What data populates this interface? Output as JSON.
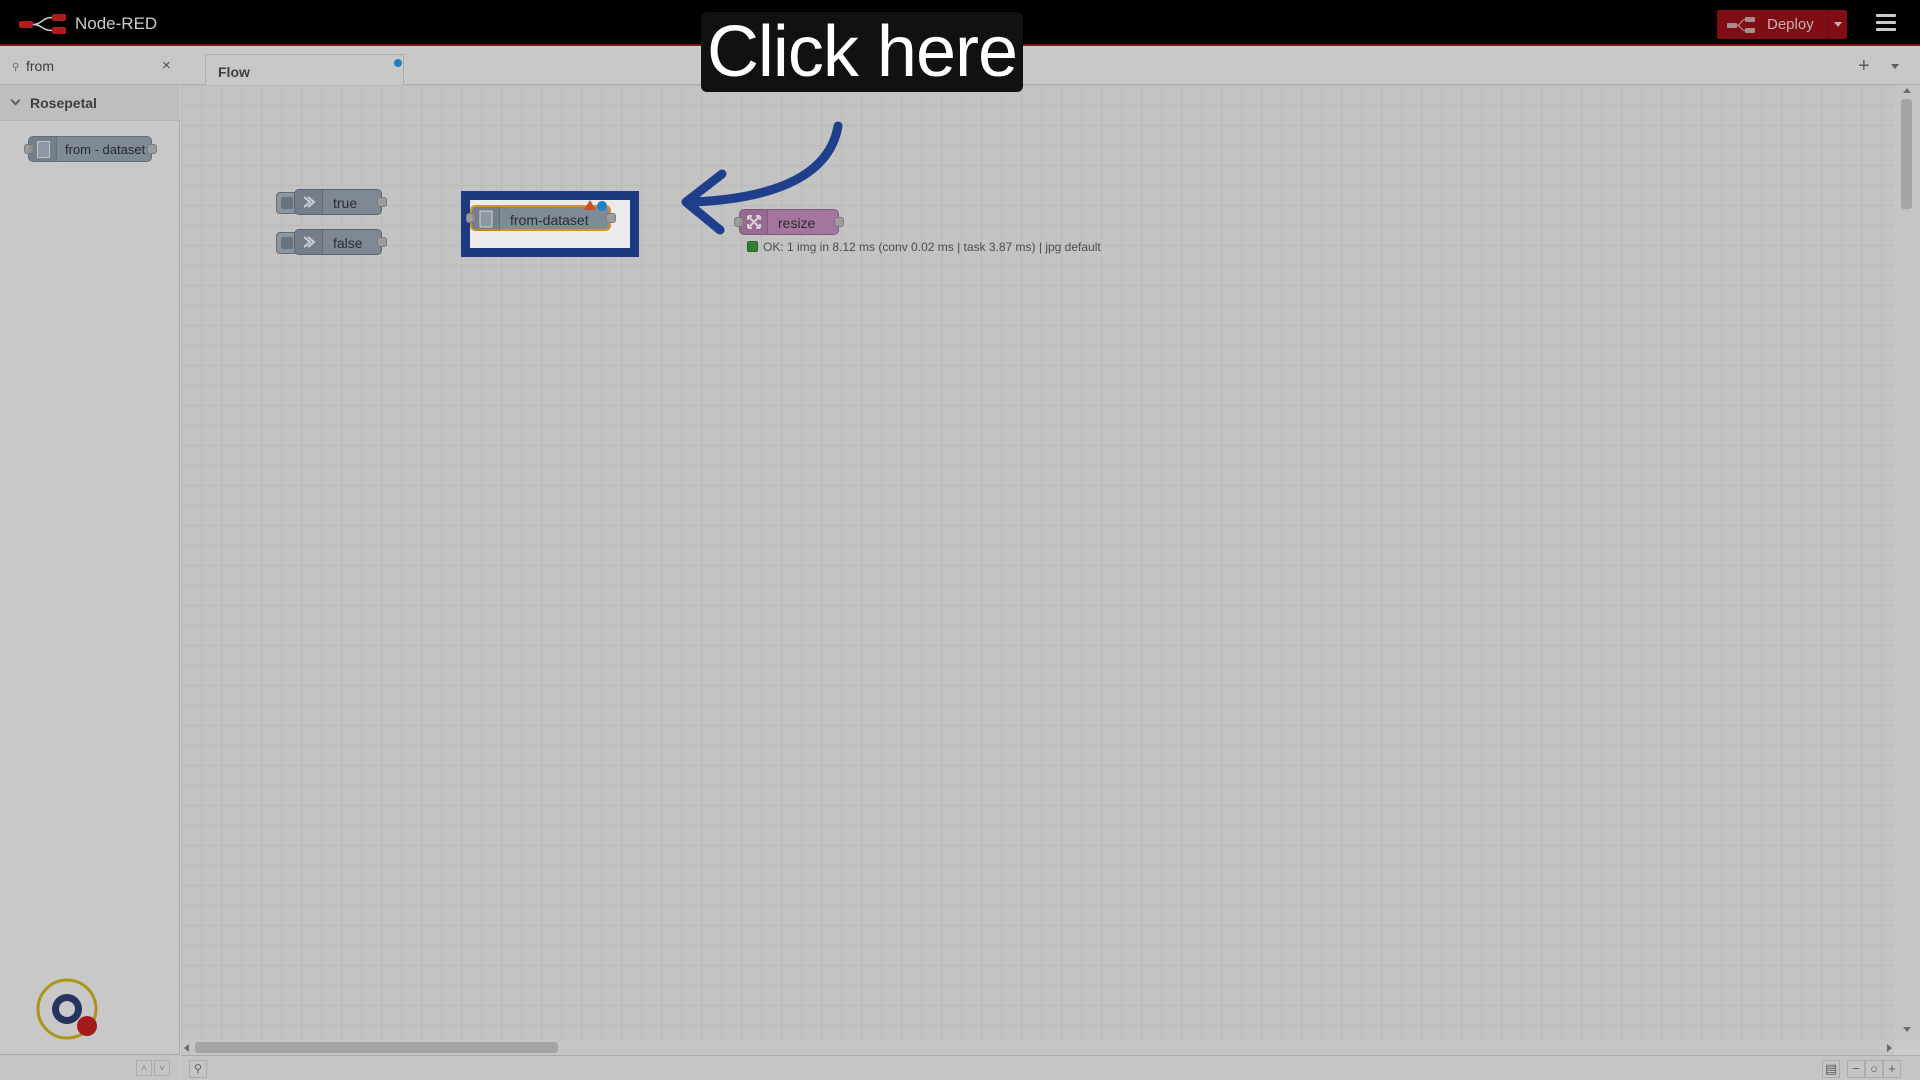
{
  "header": {
    "app_title": "Node-RED",
    "deploy_label": "Deploy"
  },
  "palette": {
    "search_value": "from",
    "category": "Rosepetal",
    "nodes": [
      "from - dataset"
    ]
  },
  "workspace": {
    "tabs": [
      {
        "label": "Flow"
      }
    ],
    "nodes": {
      "true_label": "true",
      "false_label": "false",
      "from_dataset_label": "from-dataset",
      "resize_label": "resize"
    },
    "resize_status": "OK: 1 img in 8.12 ms (conv 0.02 ms | task 3.87 ms) | jpg default"
  },
  "overlay": {
    "callout_text": "Click here"
  },
  "colors": {
    "accent_deploy": "#8b0f15",
    "highlight_border": "#1f3f8c",
    "arrow": "#1f3f8c",
    "resize_node": "#b27fab",
    "dataset_node": "#8a96a4"
  },
  "icons": [
    "node-red-logo",
    "deploy-icon",
    "hamburger-menu-icon",
    "search-icon",
    "close-icon",
    "chevron-down-icon",
    "file-icon",
    "switch-icon",
    "resize-icon",
    "plus-icon",
    "warning-triangle-icon",
    "changed-dot-icon"
  ]
}
